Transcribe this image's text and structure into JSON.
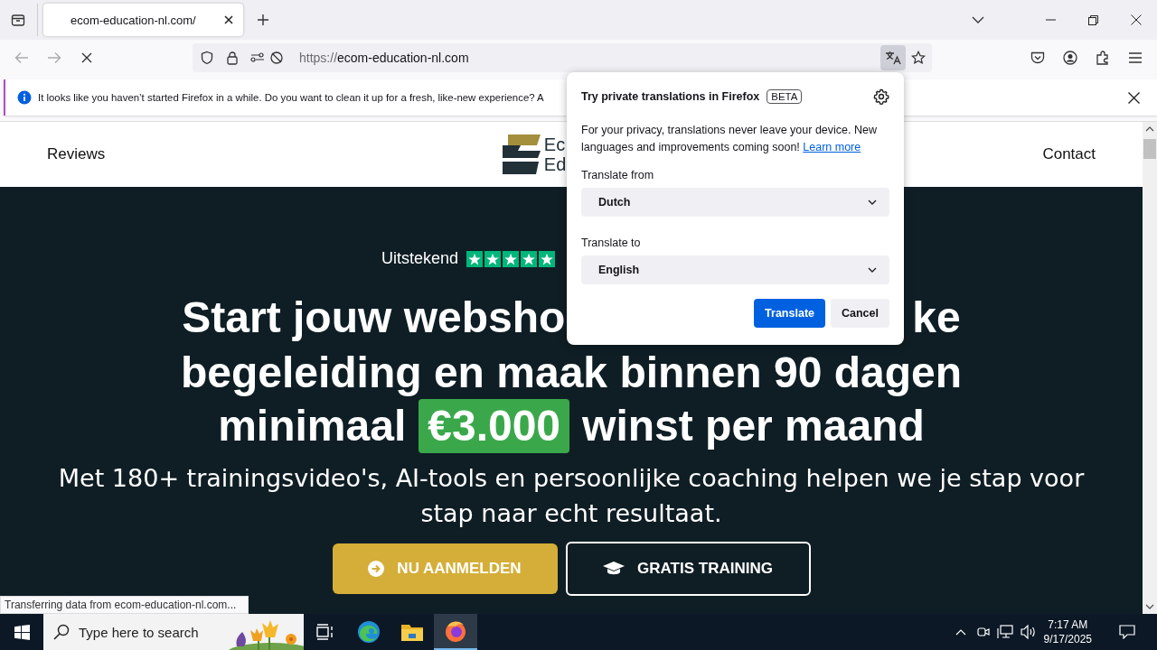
{
  "browser": {
    "tabs": [
      {
        "title": "ecom-education-nl.com/",
        "selected": true
      }
    ],
    "url": {
      "scheme": "https://",
      "host": "ecom-education-nl.com"
    },
    "loading": true,
    "notification": {
      "message": "It looks like you haven’t started Firefox in a while. Do you want to clean it up for a fresh, like-new experience? A"
    }
  },
  "site_nav": {
    "links": [
      "Reviews",
      "Contact"
    ],
    "logo_lines": [
      "Ec",
      "Ed"
    ]
  },
  "hero": {
    "rating_label": "Uitstekend",
    "stars": 5,
    "headline": {
      "line_1_left": "Start jouw websho",
      "line_1_right": "ke",
      "line_2": "begeleiding en maak binnen 90 dagen",
      "line_3_before": "minimaal",
      "highlight": "€3.000",
      "line_3_after": "winst per maand"
    },
    "subtitle": "Met 180+ trainingsvideo's, AI-tools en persoonlijke coaching helpen we je stap voor stap naar echt resultaat.",
    "buttons": [
      {
        "label": "NU AANMELDEN",
        "kind": "primary"
      },
      {
        "label": "GRATIS TRAINING",
        "kind": "outline"
      }
    ]
  },
  "status_text": "Transferring data from ecom-education-nl.com...",
  "translation_panel": {
    "title": "Try private translations in Firefox",
    "badge": "BETA",
    "description": "For your privacy, translations never leave your device. New languages and improvements coming soon!",
    "link": "Learn more",
    "from_label": "Translate from",
    "from_value": "Dutch",
    "to_label": "Translate to",
    "to_value": "English",
    "buttons": [
      {
        "label": "Translate",
        "kind": "primary"
      },
      {
        "label": "Cancel",
        "kind": "secondary"
      }
    ]
  },
  "taskbar": {
    "search_placeholder": "Type here to search",
    "apps": [
      {
        "kind": "task-view",
        "selected": false
      },
      {
        "kind": "edge",
        "selected": false
      },
      {
        "kind": "explorer",
        "selected": false
      },
      {
        "kind": "firefox",
        "selected": true
      }
    ],
    "time": "7:17 AM",
    "date": "9/17/2025"
  }
}
